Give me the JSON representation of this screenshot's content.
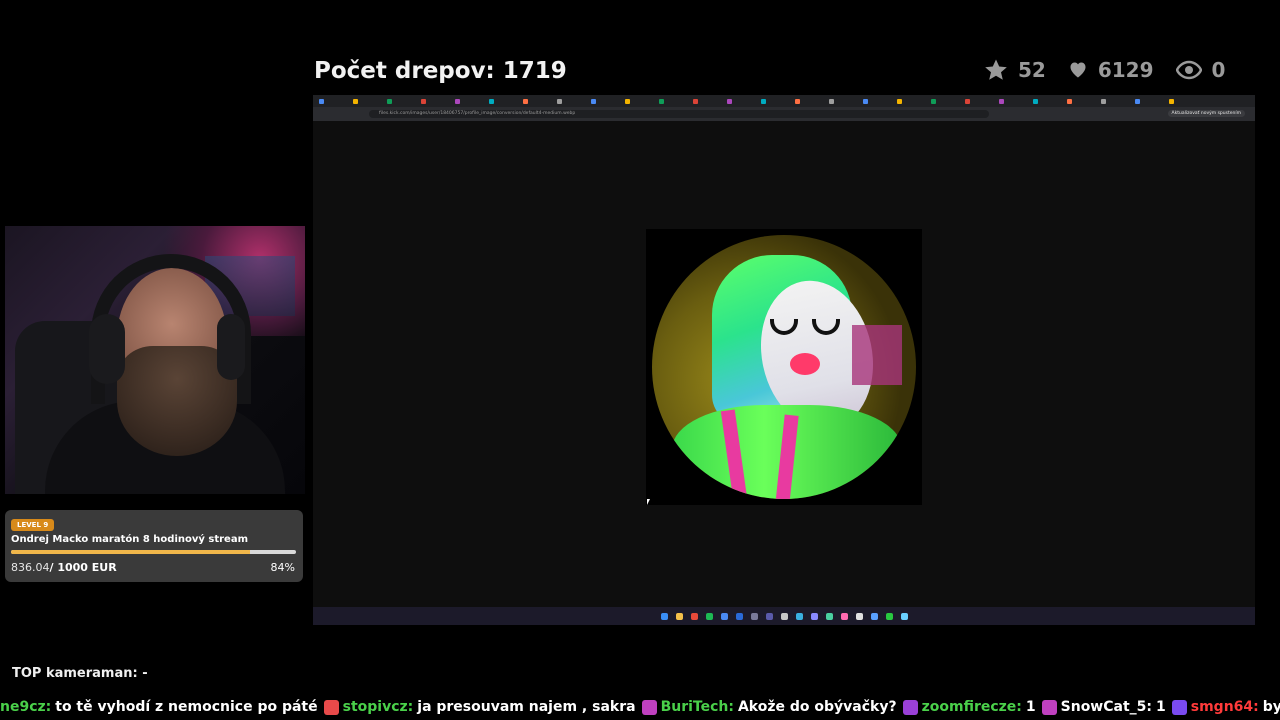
{
  "overlay": {
    "title": "Počet drepov: 1719",
    "stats": [
      {
        "icon": "star-icon",
        "value": "52"
      },
      {
        "icon": "heart-icon",
        "value": "6129"
      },
      {
        "icon": "eye-icon",
        "value": "0"
      }
    ]
  },
  "goal": {
    "level": "LEVEL 9",
    "name": "Ondrej Macko maratón 8 hodinový stream",
    "current": "836.04",
    "target": "/ 1000 EUR",
    "percent_label": "84%",
    "progress": 0.84,
    "colors": {
      "badge": "#d88a1a",
      "fill": "#f0b64a"
    }
  },
  "browser": {
    "url": "files.kick.com/images/user/18406757/profile_image/conversion/default4-medium.webp",
    "update_button": "Aktualizovať novým spustením"
  },
  "top_cameraman": "TOP kameraman: -",
  "chat": [
    {
      "user": "ne9cz:",
      "text": "to tě vyhodí z nemocnice po páté",
      "color": "#4ad04a"
    },
    {
      "user": "stopivcz:",
      "text": "ja presouvam najem , sakra",
      "color": "#4ad04a"
    },
    {
      "user": "BuriTech:",
      "text": "Akože do obývačky?",
      "color": "#4ad04a"
    },
    {
      "user": "zoomfirecze:",
      "text": "1",
      "color": "#4ad04a"
    },
    {
      "user": "SnowCat_5:",
      "text": "1",
      "color": "#ffffff"
    },
    {
      "user": "smgn64:",
      "text": "bye",
      "color": "#ff3a3a"
    }
  ]
}
